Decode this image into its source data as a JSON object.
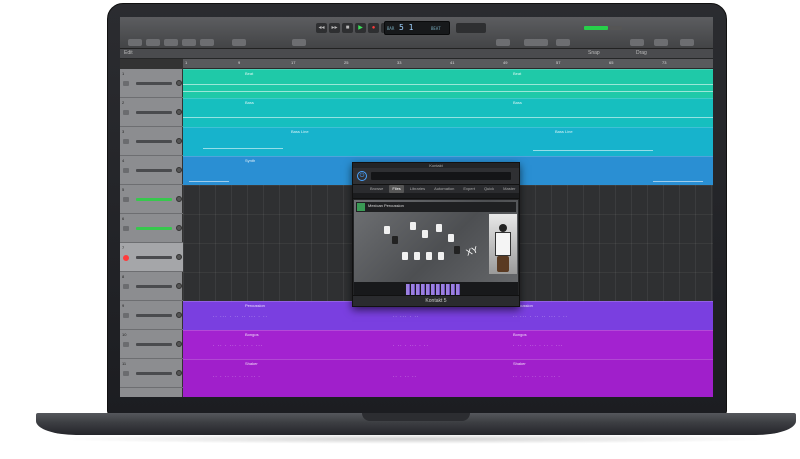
{
  "colors": {
    "teal": "#1fc9a8",
    "cyan": "#17b7c8",
    "blue": "#2a8fd3",
    "violet": "#7a3fe0",
    "magenta": "#a322d0",
    "record": "#ff3b3b",
    "play": "#3ce05a"
  },
  "icons": {
    "power": "power-icon",
    "play": "play-icon",
    "record": "record-icon"
  },
  "transport": {
    "lcd_value": "5 1",
    "lcd_small_left": "BAR",
    "lcd_small_right": "BEAT"
  },
  "header": {
    "left_label": "Edit",
    "right_label_1": "Snap",
    "right_label_2": "Drag"
  },
  "ruler": {
    "marks": [
      "1",
      "9",
      "17",
      "25",
      "33",
      "41",
      "49",
      "57",
      "65",
      "73"
    ]
  },
  "tracks": [
    {
      "name": "1",
      "fader": "grey"
    },
    {
      "name": "2",
      "fader": "grey"
    },
    {
      "name": "3",
      "fader": "grey"
    },
    {
      "name": "4",
      "fader": "grey"
    },
    {
      "name": "5",
      "fader": "green"
    },
    {
      "name": "6",
      "fader": "green"
    },
    {
      "name": "7",
      "fader": "grey",
      "rec": true,
      "selected": true
    },
    {
      "name": "8",
      "fader": "grey"
    },
    {
      "name": "9",
      "fader": "grey"
    },
    {
      "name": "10",
      "fader": "grey"
    },
    {
      "name": "11",
      "fader": "grey"
    }
  ],
  "regions": {
    "r1": "Beat",
    "r2": "Bass",
    "r3": "Bass Line",
    "r4": "Synth",
    "r5": "Percussion",
    "r6": "Bongos",
    "r7": "Shaker"
  },
  "plugin": {
    "title": "Kontakt",
    "tabs": [
      "Browse",
      "Files",
      "Libraries",
      "Automation",
      "Expert",
      "Quick",
      "Master"
    ],
    "active_tab": "Files",
    "instrument_name": "Mexican Percussion",
    "footer": "Kontakt 5",
    "signature": "XY"
  }
}
